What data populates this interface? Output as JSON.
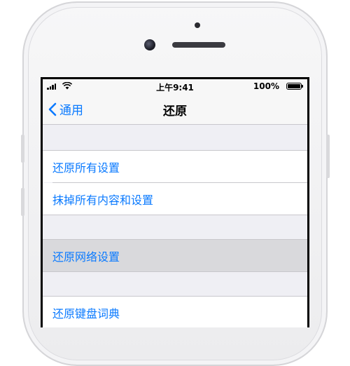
{
  "status_bar": {
    "time": "上午9:41",
    "battery_percent": "100%"
  },
  "navbar": {
    "back_label": "通用",
    "title": "还原"
  },
  "group1": [
    {
      "label": "还原所有设置"
    },
    {
      "label": "抹掉所有内容和设置"
    }
  ],
  "group2": [
    {
      "label": "还原网络设置",
      "selected": true
    }
  ],
  "group3": [
    {
      "label": "还原键盘词典"
    }
  ],
  "colors": {
    "accent": "#0a7aff",
    "background": "#efeff4",
    "selected_row": "#d9d9dc"
  }
}
